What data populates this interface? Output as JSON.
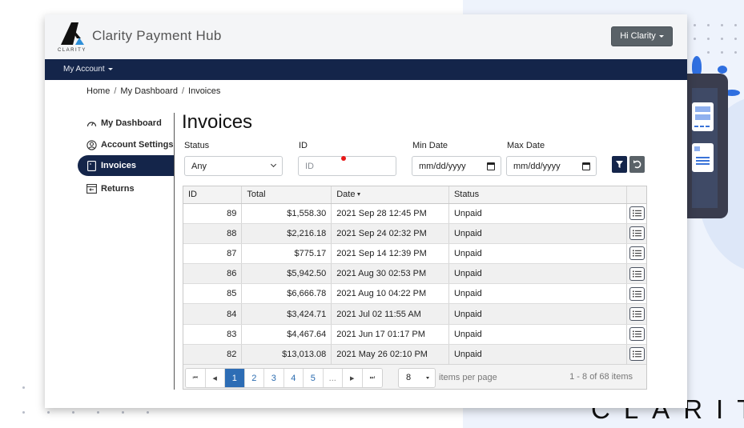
{
  "app": {
    "title": "Clarity Payment Hub",
    "logo_text": "CLARITY",
    "user_menu_label": "Hi Clarity",
    "nav_account_label": "My Account",
    "brand_watermark": "CLARITY"
  },
  "breadcrumb": {
    "items": [
      "Home",
      "My Dashboard",
      "Invoices"
    ],
    "separator": "/"
  },
  "sidebar": {
    "items": [
      {
        "label": "My Dashboard",
        "icon": "gauge-icon",
        "active": false
      },
      {
        "label": "Account Settings",
        "icon": "user-circle-icon",
        "active": false
      },
      {
        "label": "Invoices",
        "icon": "invoice-icon",
        "active": true
      },
      {
        "label": "Returns",
        "icon": "returns-icon",
        "active": false
      }
    ]
  },
  "page": {
    "title": "Invoices"
  },
  "filters": {
    "status": {
      "label": "Status",
      "value": "Any"
    },
    "id": {
      "label": "ID",
      "placeholder": "ID",
      "value": ""
    },
    "min_date": {
      "label": "Min Date",
      "placeholder": "mm/dd/yyyy"
    },
    "max_date": {
      "label": "Max Date",
      "placeholder": "mm/dd/yyyy"
    },
    "filter_button_icon": "filter-icon",
    "reset_button_icon": "undo-icon"
  },
  "table": {
    "columns": [
      "ID",
      "Total",
      "Date",
      "Status",
      ""
    ],
    "sort_column": "Date",
    "sort_direction": "desc",
    "rows": [
      {
        "id": "89",
        "total": "$1,558.30",
        "date": "2021 Sep 28 12:45 PM",
        "status": "Unpaid"
      },
      {
        "id": "88",
        "total": "$2,216.18",
        "date": "2021 Sep 24 02:32 PM",
        "status": "Unpaid"
      },
      {
        "id": "87",
        "total": "$775.17",
        "date": "2021 Sep 14 12:39 PM",
        "status": "Unpaid"
      },
      {
        "id": "86",
        "total": "$5,942.50",
        "date": "2021 Aug 30 02:53 PM",
        "status": "Unpaid"
      },
      {
        "id": "85",
        "total": "$6,666.78",
        "date": "2021 Aug 10 04:22 PM",
        "status": "Unpaid"
      },
      {
        "id": "84",
        "total": "$3,424.71",
        "date": "2021 Jul 02 11:55 AM",
        "status": "Unpaid"
      },
      {
        "id": "83",
        "total": "$4,467.64",
        "date": "2021 Jun 17 01:17 PM",
        "status": "Unpaid"
      },
      {
        "id": "82",
        "total": "$13,013.08",
        "date": "2021 May 26 02:10 PM",
        "status": "Unpaid"
      }
    ]
  },
  "pager": {
    "first": "⏮",
    "prev": "◀",
    "pages": [
      "1",
      "2",
      "3",
      "4",
      "5"
    ],
    "current_page": "1",
    "ellipsis": "...",
    "next": "▶",
    "last": "⏭",
    "page_size": "8",
    "page_size_label": "items per page",
    "info": "1 - 8 of 68 items"
  },
  "colors": {
    "navbar": "#14254a",
    "accent_blue": "#2d6db5",
    "user_button": "#5a6268"
  }
}
